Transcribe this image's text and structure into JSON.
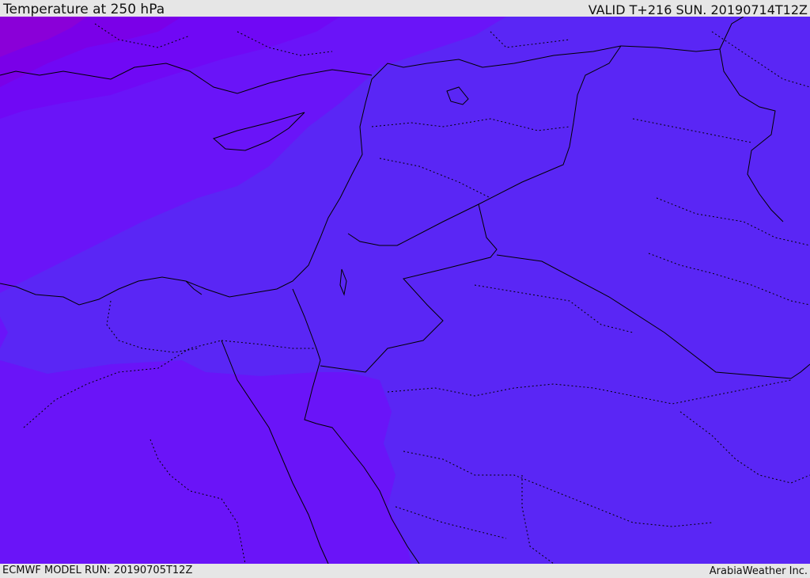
{
  "header": {
    "title": "Temperature at 250 hPa",
    "valid": "VALID T+216 SUN. 20190714T12Z"
  },
  "footer": {
    "model_run": "ECMWF MODEL RUN: 20190705T12Z",
    "credit": "ArabiaWeather Inc."
  },
  "map": {
    "field": "Temperature",
    "level": "250 hPa",
    "colors": {
      "base": "#5a26f5",
      "band_warm": "#6a14f8",
      "band_mid": "#7008f5",
      "band_cold": "#7a00e8",
      "band_coldest": "#8a00d8",
      "coastline": "#000000",
      "border": "#000000"
    }
  }
}
